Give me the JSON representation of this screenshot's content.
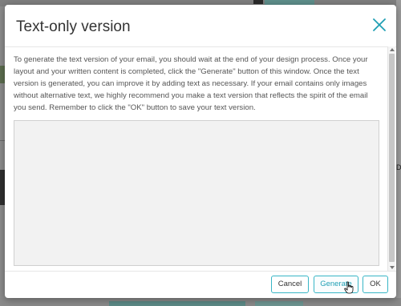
{
  "background": {
    "side_letter": "D"
  },
  "modal": {
    "title": "Text-only version",
    "description": "To generate the text version of your email, you should wait at the end of your design process. Once your layout and your written content is completed, click the \"Generate\" button of this window. Once the text version is generated, you can improve it by adding text as necessary. If your email contains only images without alternative text, we highly recommend you make a text version that reflects the spirit of the email you send. Remember to click the \"OK\" button to save your text version.",
    "text_version_value": ""
  },
  "buttons": {
    "cancel": "Cancel",
    "generate": "Generate",
    "ok": "OK"
  },
  "colors": {
    "accent": "#38b6c6",
    "close_icon": "#1f9fb4"
  },
  "icons": {
    "close": "close-icon",
    "pointer": "hand-pointer-icon"
  }
}
